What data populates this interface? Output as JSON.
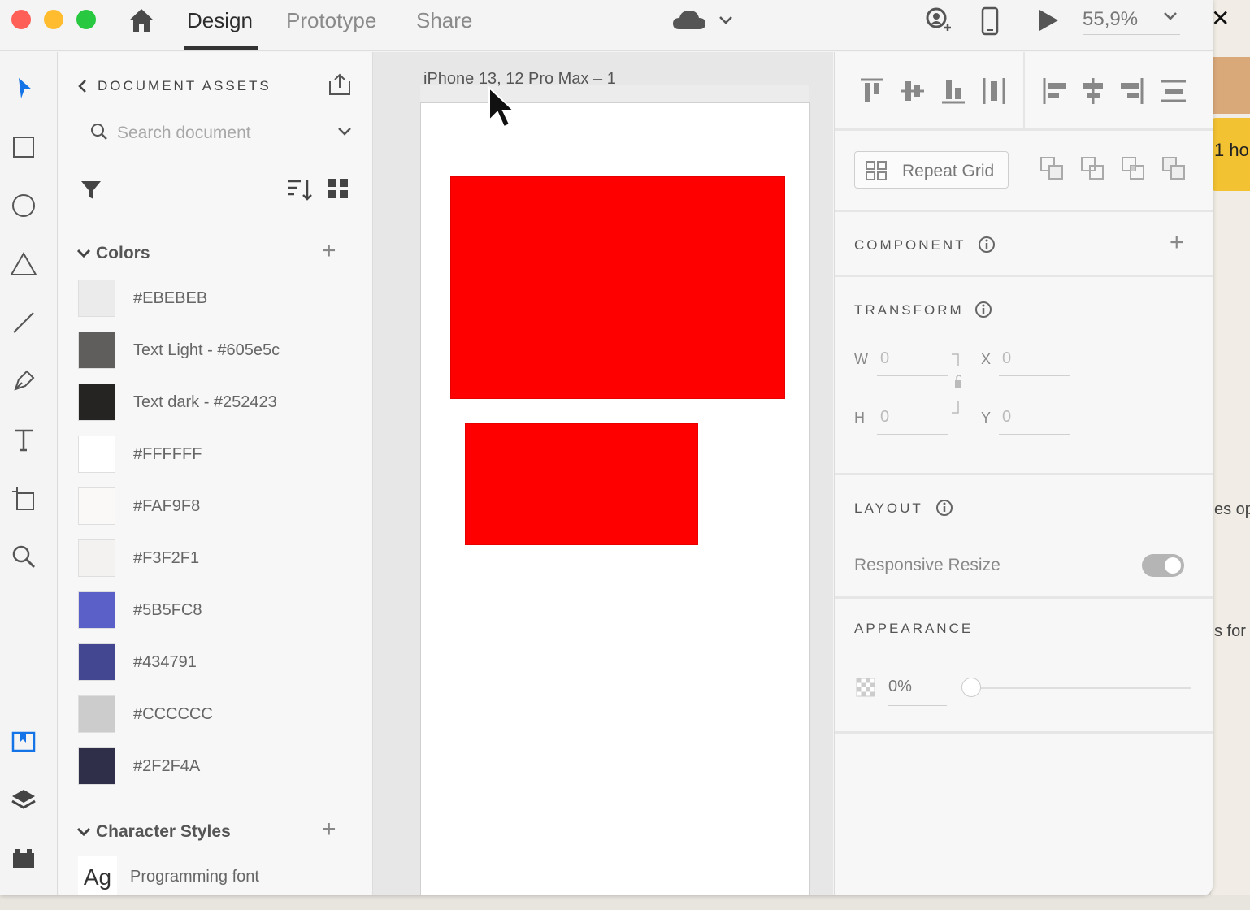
{
  "tabs": [
    {
      "label": "Design"
    },
    {
      "label": "Prototype"
    },
    {
      "label": "Share"
    }
  ],
  "zoom": "55,9%",
  "assets": {
    "title": "DOCUMENT ASSETS",
    "search_placeholder": "Search document",
    "colors_heading": "Colors",
    "colors": [
      {
        "label": "#EBEBEB",
        "hex": "#EBEBEB"
      },
      {
        "label": "Text Light - #605e5c",
        "hex": "#605e5c"
      },
      {
        "label": "Text dark - #252423",
        "hex": "#252423"
      },
      {
        "label": "#FFFFFF",
        "hex": "#FFFFFF"
      },
      {
        "label": "#FAF9F8",
        "hex": "#FAF9F8"
      },
      {
        "label": "#F3F2F1",
        "hex": "#F3F2F1"
      },
      {
        "label": "#5B5FC8",
        "hex": "#5B5FC8"
      },
      {
        "label": "#434791",
        "hex": "#434791"
      },
      {
        "label": "#CCCCCC",
        "hex": "#CCCCCC"
      },
      {
        "label": "#2F2F4A",
        "hex": "#2F2F4A"
      }
    ],
    "char_styles_heading": "Character Styles",
    "char_styles": [
      {
        "preview": "Ag",
        "label": "Programming font"
      }
    ]
  },
  "canvas": {
    "artboard_label": "iPhone 13, 12 Pro Max – 1",
    "rect_color": "#FF0000"
  },
  "props": {
    "repeat_grid": "Repeat Grid",
    "component_heading": "COMPONENT",
    "transform_heading": "TRANSFORM",
    "w_label": "W",
    "w_value": "0",
    "x_label": "X",
    "x_value": "0",
    "h_label": "H",
    "h_value": "0",
    "y_label": "Y",
    "y_value": "0",
    "layout_heading": "LAYOUT",
    "responsive_resize": "Responsive Resize",
    "appearance_heading": "APPEARANCE",
    "opacity": "0%"
  },
  "background_app": {
    "fragment_1": "1 ho",
    "fragment_2": "es op",
    "fragment_3": "s for"
  }
}
